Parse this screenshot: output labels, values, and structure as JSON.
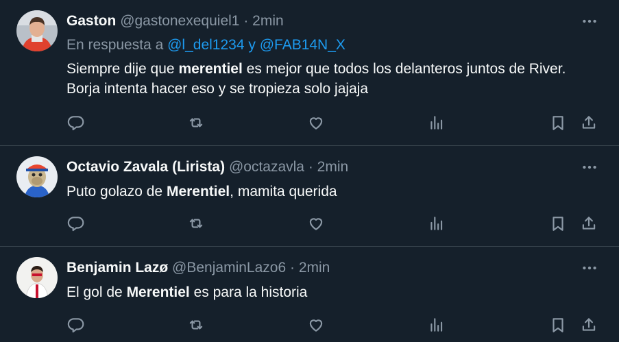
{
  "tweets": [
    {
      "name": "Gaston",
      "handle": "@gastonexequiel1",
      "time": "2min",
      "reply_prefix": "En respuesta a",
      "reply_mention1": "@l_del1234",
      "reply_and": "y",
      "reply_mention2": "@FAB14N_X",
      "text_before": "Siempre dije que ",
      "keyword": "merentiel",
      "text_after": " es mejor que todos los delanteros juntos de River. Borja intenta hacer eso y se tropieza solo jajaja"
    },
    {
      "name": "Octavio Zavala (Lirista)",
      "handle": "@octazavla",
      "time": "2min",
      "text_before": "Puto golazo de ",
      "keyword": "Merentiel",
      "text_after": ", mamita querida"
    },
    {
      "name": "Benjamin Lazø",
      "handle": "@BenjaminLazo6",
      "time": "2min",
      "text_before": "El gol de ",
      "keyword": "Merentiel",
      "text_after": " es para la historia"
    }
  ],
  "separator": "·",
  "icons": {
    "more": "more-icon",
    "reply": "reply-icon",
    "retweet": "retweet-icon",
    "like": "like-icon",
    "views": "views-icon",
    "bookmark": "bookmark-icon",
    "share": "share-icon"
  },
  "colors": {
    "background": "#15202b",
    "text": "#f7f9f9",
    "muted": "#8b98a5",
    "link": "#1d9bf0",
    "divider": "#38444d"
  }
}
